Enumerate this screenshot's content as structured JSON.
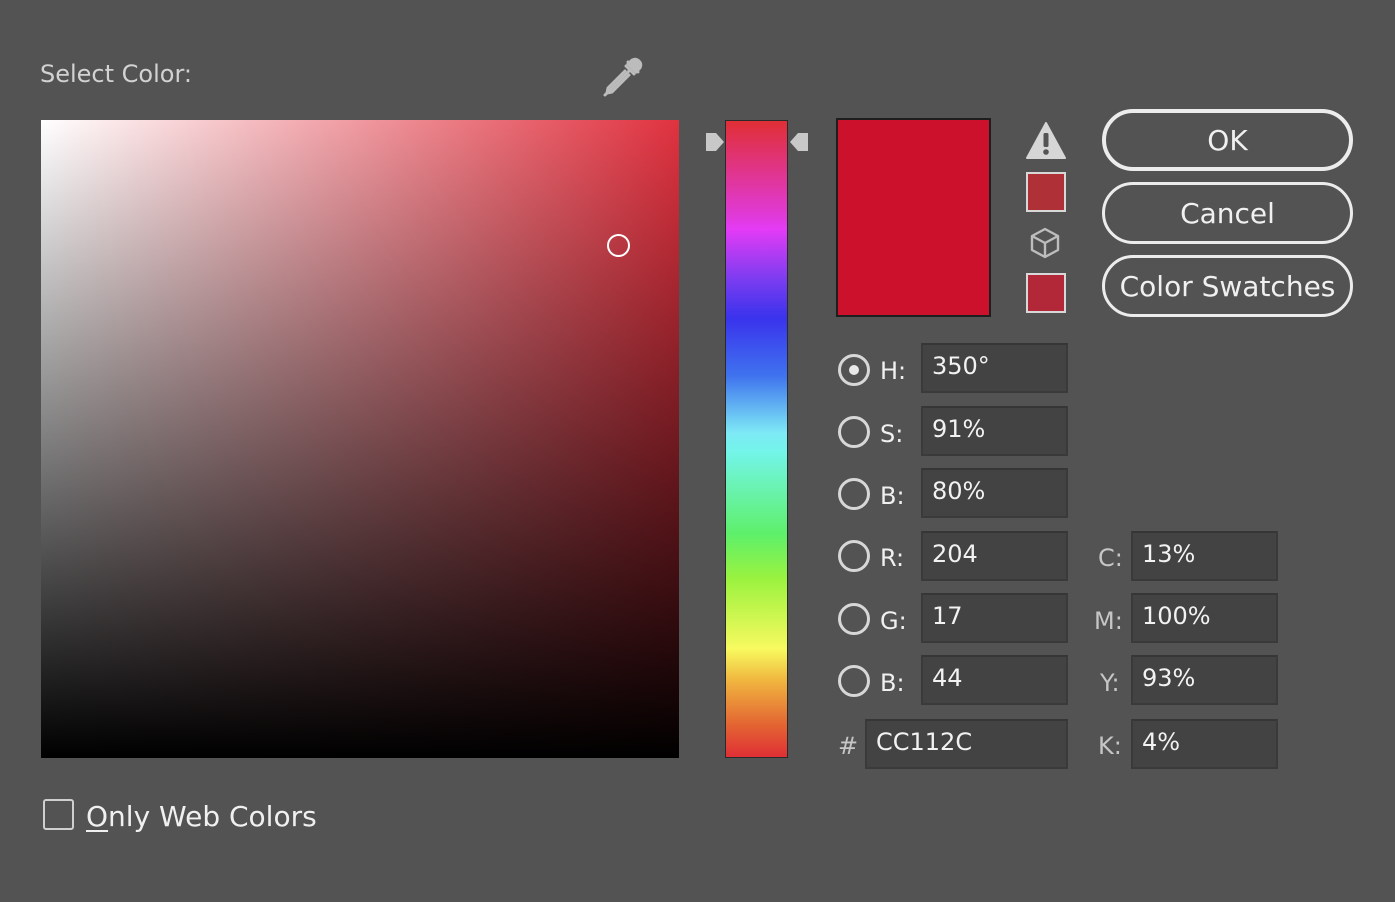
{
  "dialog": {
    "title": "Select Color:"
  },
  "current_color": {
    "hex_display": "#cc112c",
    "gamut_warning_color": "#b03038",
    "web_safe_color": "#b22838"
  },
  "picker": {
    "field_base_color": "#e0323f",
    "marker_color": "#ffffff"
  },
  "buttons": {
    "ok": "OK",
    "cancel": "Cancel",
    "swatches": "Color Swatches"
  },
  "hsb": {
    "h_label": "H:",
    "h_value": "350°",
    "s_label": "S:",
    "s_value": "91%",
    "b_label": "B:",
    "b_value": "80%"
  },
  "rgb": {
    "r_label": "R:",
    "r_value": "204",
    "g_label": "G:",
    "g_value": "17",
    "b_label": "B:",
    "b_value": "44"
  },
  "cmyk": {
    "c_label": "C:",
    "c_value": "13%",
    "m_label": "M:",
    "m_value": "100%",
    "y_label": "Y:",
    "y_value": "93%",
    "k_label": "K:",
    "k_value": "4%"
  },
  "hex": {
    "label": "#",
    "value": "CC112C"
  },
  "web_only": {
    "label_first": "O",
    "label_rest": "nly Web Colors"
  },
  "icons": {
    "eyedropper": "eyedropper-icon",
    "warning": "warning-triangle-icon",
    "cube": "cube-icon",
    "hue_arrow": "slider-arrow-icon"
  }
}
